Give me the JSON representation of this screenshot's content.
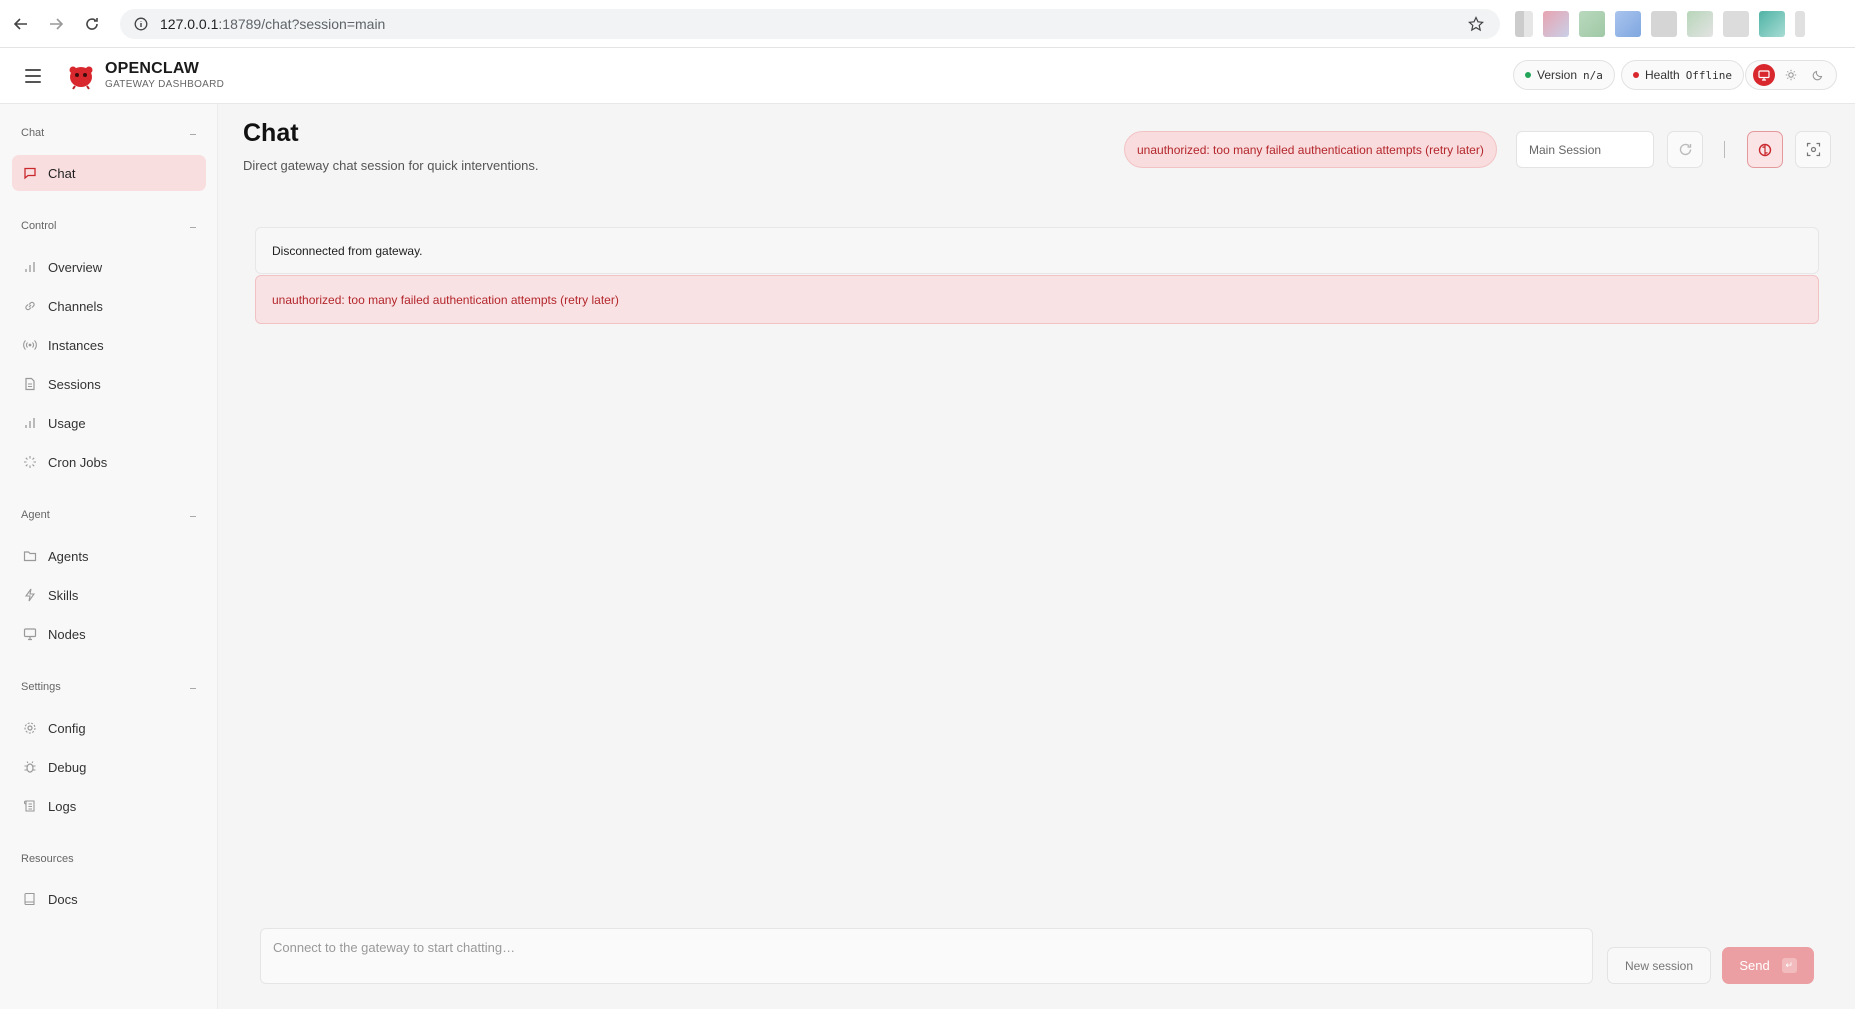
{
  "browser": {
    "url_host": "127.0.0.1",
    "url_path": ":18789/chat?session=main"
  },
  "header": {
    "brand_title": "OPENCLAW",
    "brand_subtitle": "GATEWAY DASHBOARD",
    "version_label": "Version",
    "version_value": "n/a",
    "health_label": "Health",
    "health_value": "Offline",
    "version_dot_color": "#22a559",
    "health_dot_color": "#d9272e"
  },
  "sidebar": {
    "groups": [
      {
        "label": "Chat",
        "items": [
          {
            "label": "Chat",
            "icon": "message-icon",
            "active": true
          }
        ]
      },
      {
        "label": "Control",
        "items": [
          {
            "label": "Overview",
            "icon": "bar-chart-icon"
          },
          {
            "label": "Channels",
            "icon": "link-icon"
          },
          {
            "label": "Instances",
            "icon": "radio-icon"
          },
          {
            "label": "Sessions",
            "icon": "document-icon"
          },
          {
            "label": "Usage",
            "icon": "bar-chart-icon"
          },
          {
            "label": "Cron Jobs",
            "icon": "loader-icon"
          }
        ]
      },
      {
        "label": "Agent",
        "items": [
          {
            "label": "Agents",
            "icon": "folder-icon"
          },
          {
            "label": "Skills",
            "icon": "bolt-icon"
          },
          {
            "label": "Nodes",
            "icon": "monitor-icon"
          }
        ]
      },
      {
        "label": "Settings",
        "items": [
          {
            "label": "Config",
            "icon": "gear-icon"
          },
          {
            "label": "Debug",
            "icon": "bug-icon"
          },
          {
            "label": "Logs",
            "icon": "scroll-icon"
          }
        ]
      },
      {
        "label": "Resources",
        "items": [
          {
            "label": "Docs",
            "icon": "book-icon"
          }
        ]
      }
    ]
  },
  "main": {
    "title": "Chat",
    "subtitle": "Direct gateway chat session for quick interventions.",
    "error_pill": "unauthorized: too many failed authentication attempts (retry later)",
    "session_select": "Main Session",
    "notices": {
      "info": "Disconnected from gateway.",
      "error": "unauthorized: too many failed authentication attempts (retry later)"
    },
    "composer_placeholder": "Connect to the gateway to start chatting…",
    "new_session_label": "New session",
    "send_label": "Send",
    "accent_color": "#d9272e"
  }
}
